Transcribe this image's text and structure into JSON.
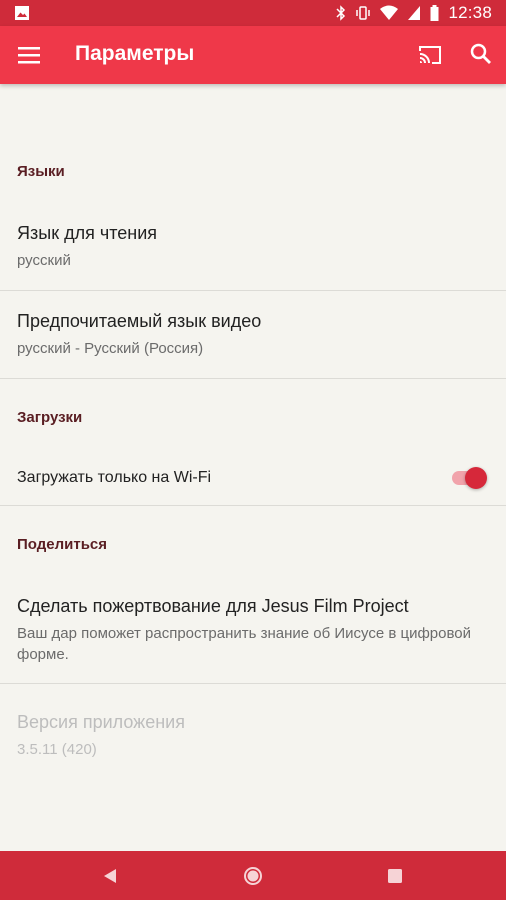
{
  "status_bar": {
    "time": "12:38",
    "icons": [
      "image-icon",
      "bluetooth-icon",
      "vibrate-icon",
      "wifi-icon",
      "cellular-icon",
      "battery-icon"
    ]
  },
  "app_bar": {
    "title": "Параметры",
    "icons": [
      "menu-icon",
      "cast-icon",
      "search-icon"
    ],
    "color": "#ef3849"
  },
  "sections": {
    "languages": {
      "header": "Языки",
      "reading_language": {
        "title": "Язык для чтения",
        "value": "русский"
      },
      "video_language": {
        "title": "Предпочитаемый язык видео",
        "value": "русский - Русский (Россия)"
      }
    },
    "downloads": {
      "header": "Загрузки",
      "wifi_only": {
        "label": "Загружать только на Wi-Fi",
        "enabled": true
      }
    },
    "share": {
      "header": "Поделиться",
      "donate": {
        "title": "Сделать пожертвование для Jesus Film Project",
        "description": "Ваш дар поможет распространить знание об Иисусе в цифровой форме."
      }
    },
    "version": {
      "title": "Версия приложения",
      "value": "3.5.11 (420)"
    }
  },
  "nav_bar": {
    "icons": [
      "back-icon",
      "home-icon",
      "recents-icon"
    ]
  }
}
